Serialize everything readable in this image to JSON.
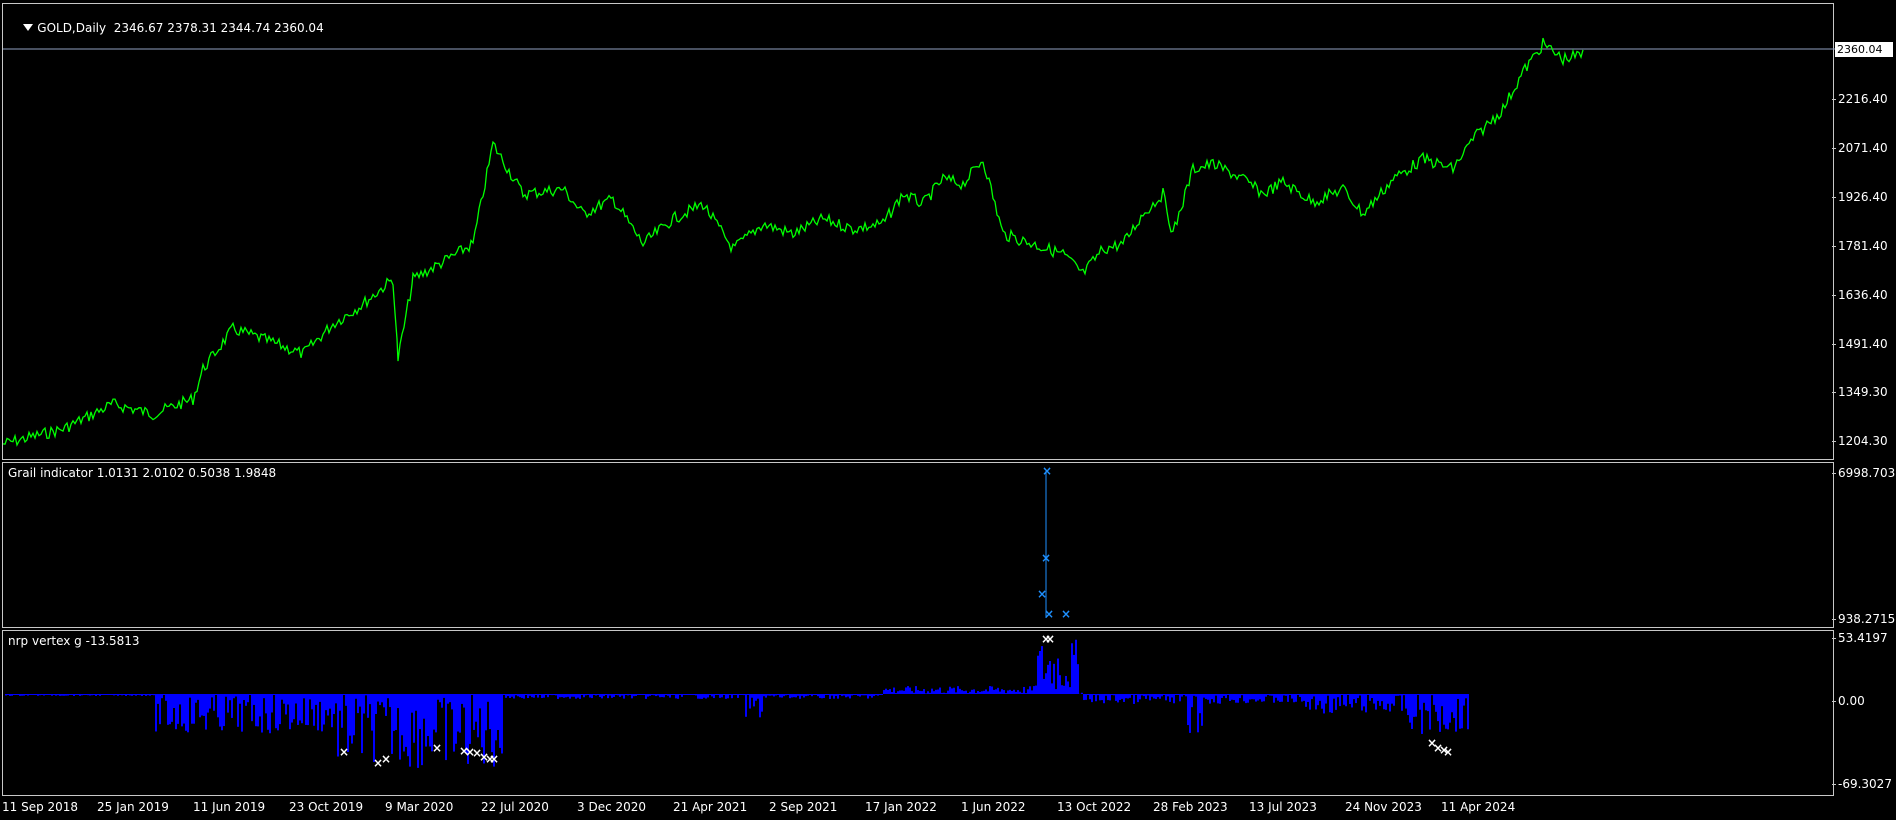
{
  "main": {
    "symbol": "GOLD,Daily",
    "ohlc": "2346.67 2378.31 2344.74 2360.04",
    "price_tag": "2360.04",
    "y_ticks": [
      "2216.40",
      "2071.40",
      "1926.40",
      "1781.40",
      "1636.40",
      "1491.40",
      "1349.30",
      "1204.30"
    ],
    "line_color": "#00ff00"
  },
  "grail": {
    "title": "Grail indicator 1.0131 2.0102 0.5038 1.9848",
    "y_top": "6998.7037",
    "y_bottom": "938.2715",
    "marker_color": "#1e90ff"
  },
  "nrp": {
    "title": "nrp vertex g -13.5813",
    "y_ticks": [
      "53.4197",
      "0.00",
      "-69.3027"
    ],
    "bar_color": "#0000ff",
    "marker_color": "#ffffff"
  },
  "x_axis": [
    "11 Sep 2018",
    "25 Jan 2019",
    "11 Jun 2019",
    "23 Oct 2019",
    "9 Mar 2020",
    "22 Jul 2020",
    "3 Dec 2020",
    "21 Apr 2021",
    "2 Sep 2021",
    "17 Jan 2022",
    "1 Jun 2022",
    "13 Oct 2022",
    "28 Feb 2023",
    "13 Jul 2023",
    "24 Nov 2023",
    "11 Apr 2024"
  ],
  "icons": {
    "menu": "dropdown-triangle-icon"
  }
}
